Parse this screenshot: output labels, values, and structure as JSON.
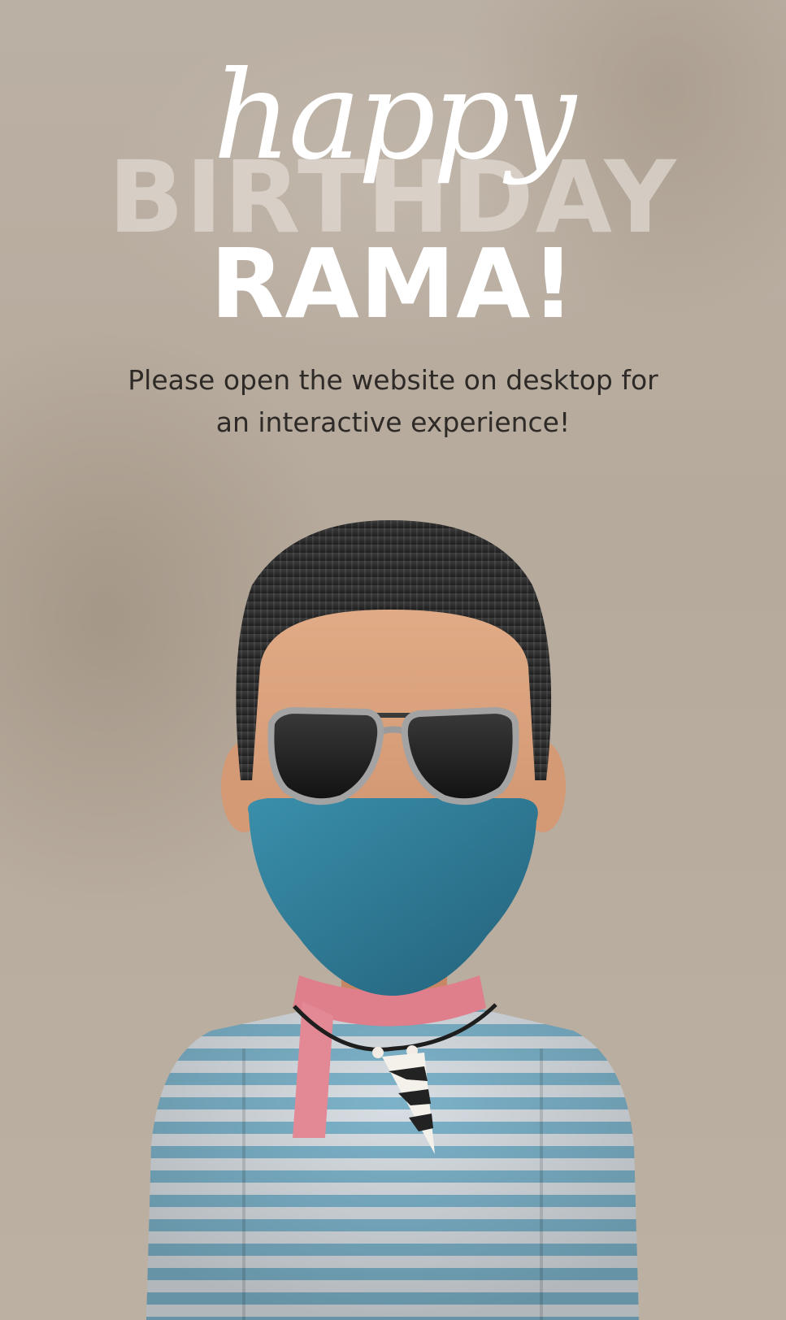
{
  "greeting": {
    "happy": "happy",
    "birthday": "BIRTHDAY",
    "name": "RAMA!"
  },
  "message": {
    "line1": "Please open the website on desktop for",
    "line2": "an interactive experience!"
  },
  "colors": {
    "background": "#b9ada0",
    "headline": "#ffffff",
    "birthday_watermark": "#e8e2db",
    "message_text": "#2e2a27",
    "mask": "#2f7f98",
    "scarf": "#e07f8c",
    "shirt_stripe": "#7ab2c9",
    "hair": "#2a2a2a",
    "skin": "#d49a76"
  },
  "avatar": {
    "icon": "avatar-illustration"
  }
}
